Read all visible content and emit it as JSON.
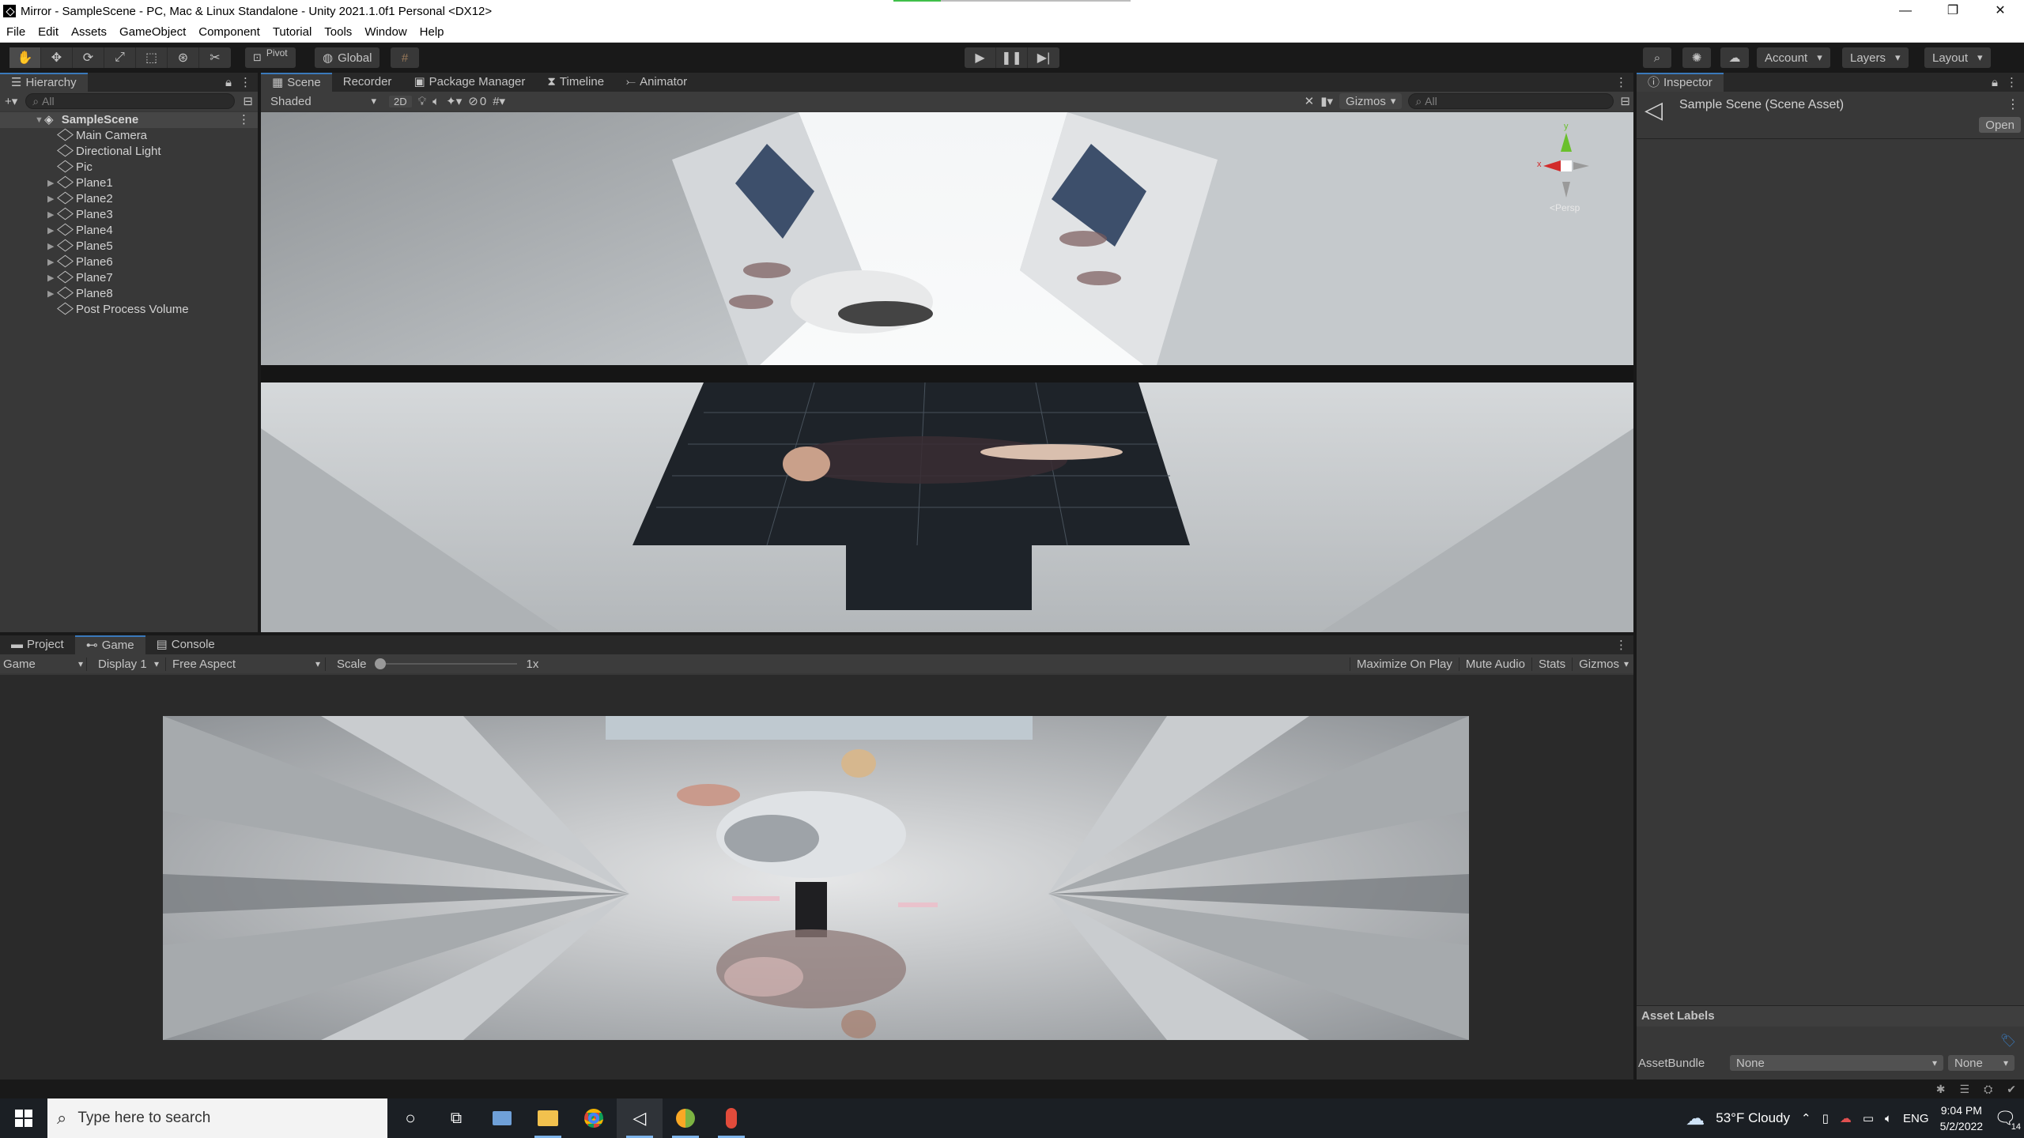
{
  "window": {
    "title": "Mirror - SampleScene - PC, Mac & Linux Standalone - Unity 2021.1.0f1 Personal <DX12>",
    "controls": [
      "—",
      "❐",
      "✕"
    ]
  },
  "menu": [
    "File",
    "Edit",
    "Assets",
    "GameObject",
    "Component",
    "Tutorial",
    "Tools",
    "Window",
    "Help"
  ],
  "toolbar": {
    "pivot_label": "Pivot",
    "global_label": "Global",
    "account_label": "Account",
    "layers_label": "Layers",
    "layout_label": "Layout"
  },
  "hierarchy": {
    "tab_label": "Hierarchy",
    "search_placeholder": "All",
    "scene_name": "SampleScene",
    "items": [
      {
        "label": "Main Camera",
        "expandable": false
      },
      {
        "label": "Directional Light",
        "expandable": false
      },
      {
        "label": "Pic",
        "expandable": false
      },
      {
        "label": "Plane1",
        "expandable": true
      },
      {
        "label": "Plane2",
        "expandable": true
      },
      {
        "label": "Plane3",
        "expandable": true
      },
      {
        "label": "Plane4",
        "expandable": true
      },
      {
        "label": "Plane5",
        "expandable": true
      },
      {
        "label": "Plane6",
        "expandable": true
      },
      {
        "label": "Plane7",
        "expandable": true
      },
      {
        "label": "Plane8",
        "expandable": true
      },
      {
        "label": "Post Process Volume",
        "expandable": false
      }
    ]
  },
  "scene_panel": {
    "tabs": [
      "Scene",
      "Recorder",
      "Package Manager",
      "Timeline",
      "Animator"
    ],
    "active_tab": "Scene",
    "shading_mode": "Shaded",
    "mode_2d": "2D",
    "hidden_count": "0",
    "gizmos_label": "Gizmos",
    "search_placeholder": "All",
    "axis_labels": {
      "x": "x",
      "y": "y"
    },
    "persp_label": "<Persp"
  },
  "inspector": {
    "tab_label": "Inspector",
    "asset_title": "Sample Scene (Scene Asset)",
    "open_button": "Open",
    "asset_labels_heading": "Asset Labels",
    "assetbundle_label": "AssetBundle",
    "assetbundle_value": "None",
    "assetbundle_variant": "None"
  },
  "bottom_panel": {
    "tabs": [
      "Project",
      "Game",
      "Console"
    ],
    "active_tab": "Game",
    "game_dropdown": "Game",
    "display_dropdown": "Display 1",
    "aspect_dropdown": "Free Aspect",
    "scale_label": "Scale",
    "scale_value": "1x",
    "scale_level": 0.0,
    "right_buttons": [
      "Maximize On Play",
      "Mute Audio",
      "Stats",
      "Gizmos"
    ]
  },
  "taskbar": {
    "search_placeholder": "Type here to search",
    "weather": "53°F  Cloudy",
    "language": "ENG",
    "time": "9:04 PM",
    "date": "5/2/2022",
    "notification_count": "14"
  }
}
